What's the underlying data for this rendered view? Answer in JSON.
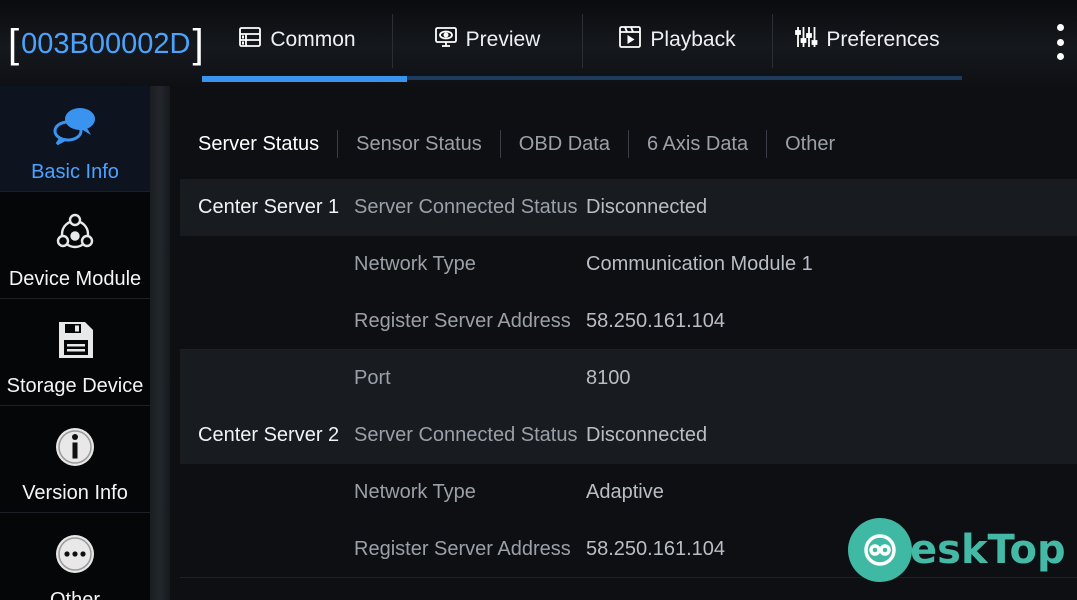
{
  "header": {
    "device_id": "003B00002D",
    "bracket_open": "[",
    "bracket_close": "]"
  },
  "top_tabs": [
    {
      "label": "Common",
      "icon": "grid-icon",
      "active": true
    },
    {
      "label": "Preview",
      "icon": "monitor-eye-icon",
      "active": false
    },
    {
      "label": "Playback",
      "icon": "film-play-icon",
      "active": false
    },
    {
      "label": "Preferences",
      "icon": "sliders-icon",
      "active": false
    }
  ],
  "sidebar": {
    "items": [
      {
        "label": "Basic Info",
        "icon": "chat-bubbles-icon",
        "active": true
      },
      {
        "label": "Device Module",
        "icon": "module-nodes-icon",
        "active": false
      },
      {
        "label": "Storage Device",
        "icon": "floppy-disk-icon",
        "active": false
      },
      {
        "label": "Version Info",
        "icon": "info-icon",
        "active": false
      },
      {
        "label": "Other",
        "icon": "more-dots-icon",
        "active": false
      }
    ]
  },
  "sub_tabs": [
    {
      "label": "Server Status",
      "active": true
    },
    {
      "label": "Sensor Status",
      "active": false
    },
    {
      "label": "OBD Data",
      "active": false
    },
    {
      "label": "6 Axis Data",
      "active": false
    },
    {
      "label": "Other",
      "active": false
    }
  ],
  "rows": [
    {
      "group": "Center Server 1",
      "field": "Server Connected Status",
      "value": "Disconnected"
    },
    {
      "group": "",
      "field": "Network Type",
      "value": "Communication Module 1"
    },
    {
      "group": "",
      "field": "Register Server Address",
      "value": "58.250.161.104"
    },
    {
      "group": "",
      "field": "Port",
      "value": "8100"
    },
    {
      "group": "Center Server 2",
      "field": "Server Connected Status",
      "value": "Disconnected"
    },
    {
      "group": "",
      "field": "Network Type",
      "value": "Adaptive"
    },
    {
      "group": "",
      "field": "Register Server Address",
      "value": "58.250.161.104"
    }
  ],
  "watermark": {
    "text": "eskTop"
  },
  "colors": {
    "accent": "#3b93f0",
    "device_id": "#4aa3ff",
    "watermark": "#43b9a6"
  }
}
